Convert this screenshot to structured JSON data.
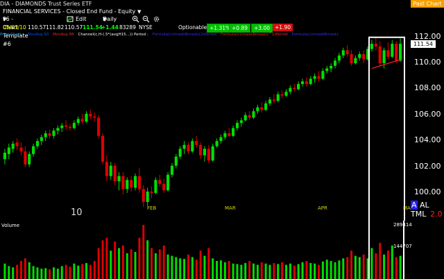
{
  "window": {
    "title": "DIA - DIAMONDS Trust Series ETF",
    "action_button": "Past Chart"
  },
  "security": {
    "description": "FINANCIAL SERVICES - Closed End Fund - Equity",
    "template": "F6 - Chart Template #6",
    "edit_label": "Edit",
    "period": "Daily"
  },
  "quote": {
    "date": "05/03/10",
    "open": "110.57",
    "high": "111.82",
    "low": "110.57",
    "last": "111.54",
    "change": "+1.44",
    "volume": "83289",
    "exchange": "NYSE",
    "optionable": "Optionable",
    "box1": "+1.31%",
    "box2": "+0.89",
    "box3": "+3.00",
    "box4": "+1.90"
  },
  "studies": [
    {
      "label": "Price Chart :",
      "color": "#00a0ff"
    },
    {
      "label": "MovAvg 50",
      "color": "#0050ff"
    },
    {
      "label": "MovAvg 88",
      "color": "#ff2020"
    },
    {
      "label": "Channel(c,H-(.5*(avgH15...)) Period :",
      "color": "#ffffff"
    },
    {
      "label": "Formula(c)(maskBmask)(2)Period",
      "color": "#3030ff"
    },
    {
      "label": "Formula(c)(maskBmask)(^2)Period",
      "color": "#ff2020"
    },
    {
      "label": "Formula(c)(maskBmask)",
      "color": "#3030ff"
    }
  ],
  "axis": {
    "y_labels": [
      "112.00",
      "110.00",
      "108.00",
      "106.00",
      "104.00",
      "102.00",
      "100.00"
    ],
    "last_price_tag": "111.54",
    "x_labels": [
      "FEB",
      "MAR",
      "APR",
      "MA"
    ],
    "x_first": "10",
    "right_indicator": "AL TML",
    "right_indicator_letter": "A",
    "right_number": "2.0"
  },
  "volume": {
    "label": "Volume",
    "scale_labels": [
      "289414",
      "144707"
    ]
  },
  "colors": {
    "up": "#00e000",
    "down": "#e00000",
    "background": "#000000",
    "accent": "#f5a000"
  },
  "icons": [
    "dropdown-icon",
    "zoom-in-icon",
    "zoom-out-icon",
    "chart-settings-icon",
    "settings-icon"
  ],
  "chart_data": {
    "type": "candlestick",
    "ylim": [
      98.5,
      112.2
    ],
    "x_labels": [
      "FEB",
      "MAR",
      "APR",
      "MA"
    ],
    "candles": [
      {
        "o": 102.6,
        "h": 103.4,
        "l": 102.2,
        "c": 103.1
      },
      {
        "o": 103.0,
        "h": 103.8,
        "l": 102.6,
        "c": 103.5
      },
      {
        "o": 103.4,
        "h": 104.0,
        "l": 103.1,
        "c": 103.8
      },
      {
        "o": 103.9,
        "h": 104.2,
        "l": 103.3,
        "c": 103.6
      },
      {
        "o": 103.5,
        "h": 103.9,
        "l": 102.9,
        "c": 103.2
      },
      {
        "o": 103.2,
        "h": 103.6,
        "l": 102.0,
        "c": 102.2
      },
      {
        "o": 102.2,
        "h": 103.2,
        "l": 102.0,
        "c": 103.0
      },
      {
        "o": 103.0,
        "h": 103.8,
        "l": 102.8,
        "c": 103.6
      },
      {
        "o": 103.6,
        "h": 104.2,
        "l": 103.4,
        "c": 104.0
      },
      {
        "o": 104.0,
        "h": 104.5,
        "l": 103.7,
        "c": 104.3
      },
      {
        "o": 104.3,
        "h": 104.8,
        "l": 104.0,
        "c": 104.6
      },
      {
        "o": 104.6,
        "h": 104.9,
        "l": 104.2,
        "c": 104.4
      },
      {
        "o": 104.4,
        "h": 105.0,
        "l": 104.2,
        "c": 104.8
      },
      {
        "o": 104.8,
        "h": 105.2,
        "l": 104.5,
        "c": 105.0
      },
      {
        "o": 105.0,
        "h": 105.4,
        "l": 104.7,
        "c": 105.2
      },
      {
        "o": 105.2,
        "h": 105.6,
        "l": 104.9,
        "c": 105.1
      },
      {
        "o": 105.1,
        "h": 105.3,
        "l": 104.8,
        "c": 105.0
      },
      {
        "o": 105.0,
        "h": 105.6,
        "l": 104.9,
        "c": 105.4
      },
      {
        "o": 105.4,
        "h": 105.9,
        "l": 105.2,
        "c": 105.7
      },
      {
        "o": 105.7,
        "h": 106.1,
        "l": 105.3,
        "c": 105.5
      },
      {
        "o": 105.5,
        "h": 106.3,
        "l": 105.4,
        "c": 106.1
      },
      {
        "o": 106.1,
        "h": 106.4,
        "l": 105.7,
        "c": 105.9
      },
      {
        "o": 105.9,
        "h": 106.2,
        "l": 105.5,
        "c": 105.8
      },
      {
        "o": 105.8,
        "h": 106.0,
        "l": 104.2,
        "c": 104.4
      },
      {
        "o": 104.4,
        "h": 104.6,
        "l": 102.2,
        "c": 102.4
      },
      {
        "o": 102.4,
        "h": 102.9,
        "l": 100.9,
        "c": 101.3
      },
      {
        "o": 101.3,
        "h": 102.4,
        "l": 101.0,
        "c": 102.1
      },
      {
        "o": 102.1,
        "h": 102.3,
        "l": 100.6,
        "c": 100.9
      },
      {
        "o": 100.9,
        "h": 101.6,
        "l": 100.2,
        "c": 101.3
      },
      {
        "o": 101.3,
        "h": 101.6,
        "l": 99.9,
        "c": 100.3
      },
      {
        "o": 100.3,
        "h": 101.2,
        "l": 100.0,
        "c": 101.0
      },
      {
        "o": 101.0,
        "h": 101.3,
        "l": 100.1,
        "c": 100.4
      },
      {
        "o": 100.4,
        "h": 101.5,
        "l": 100.2,
        "c": 101.3
      },
      {
        "o": 101.3,
        "h": 101.9,
        "l": 100.0,
        "c": 100.3
      },
      {
        "o": 100.3,
        "h": 100.6,
        "l": 98.9,
        "c": 99.3
      },
      {
        "o": 99.3,
        "h": 100.4,
        "l": 99.0,
        "c": 100.1
      },
      {
        "o": 100.1,
        "h": 100.5,
        "l": 99.6,
        "c": 100.0
      },
      {
        "o": 100.0,
        "h": 101.2,
        "l": 99.9,
        "c": 101.0
      },
      {
        "o": 101.0,
        "h": 101.4,
        "l": 100.5,
        "c": 100.7
      },
      {
        "o": 100.7,
        "h": 101.1,
        "l": 100.0,
        "c": 100.2
      },
      {
        "o": 100.2,
        "h": 101.6,
        "l": 100.1,
        "c": 101.4
      },
      {
        "o": 101.4,
        "h": 102.3,
        "l": 101.2,
        "c": 102.1
      },
      {
        "o": 102.1,
        "h": 103.0,
        "l": 101.9,
        "c": 102.8
      },
      {
        "o": 102.8,
        "h": 103.6,
        "l": 102.6,
        "c": 103.4
      },
      {
        "o": 103.4,
        "h": 104.0,
        "l": 103.0,
        "c": 103.7
      },
      {
        "o": 103.7,
        "h": 103.9,
        "l": 103.0,
        "c": 103.2
      },
      {
        "o": 103.2,
        "h": 104.2,
        "l": 103.1,
        "c": 104.0
      },
      {
        "o": 104.0,
        "h": 104.4,
        "l": 103.5,
        "c": 103.7
      },
      {
        "o": 103.7,
        "h": 103.9,
        "l": 102.6,
        "c": 102.9
      },
      {
        "o": 102.9,
        "h": 103.6,
        "l": 102.4,
        "c": 103.4
      },
      {
        "o": 103.4,
        "h": 103.7,
        "l": 102.3,
        "c": 102.5
      },
      {
        "o": 102.5,
        "h": 103.8,
        "l": 102.4,
        "c": 103.6
      },
      {
        "o": 103.6,
        "h": 104.2,
        "l": 103.5,
        "c": 104.0
      },
      {
        "o": 104.0,
        "h": 104.5,
        "l": 103.8,
        "c": 104.3
      },
      {
        "o": 104.3,
        "h": 104.8,
        "l": 104.1,
        "c": 104.6
      },
      {
        "o": 104.6,
        "h": 105.0,
        "l": 104.3,
        "c": 104.4
      },
      {
        "o": 104.4,
        "h": 105.2,
        "l": 104.3,
        "c": 105.0
      },
      {
        "o": 105.0,
        "h": 105.6,
        "l": 104.8,
        "c": 105.4
      },
      {
        "o": 105.4,
        "h": 105.8,
        "l": 105.1,
        "c": 105.6
      },
      {
        "o": 105.6,
        "h": 106.2,
        "l": 105.5,
        "c": 106.0
      },
      {
        "o": 106.0,
        "h": 106.3,
        "l": 105.6,
        "c": 105.8
      },
      {
        "o": 105.8,
        "h": 106.5,
        "l": 105.7,
        "c": 106.3
      },
      {
        "o": 106.3,
        "h": 106.8,
        "l": 106.1,
        "c": 106.6
      },
      {
        "o": 106.6,
        "h": 107.0,
        "l": 106.2,
        "c": 106.4
      },
      {
        "o": 106.4,
        "h": 107.1,
        "l": 106.3,
        "c": 106.9
      },
      {
        "o": 106.9,
        "h": 107.4,
        "l": 106.7,
        "c": 107.2
      },
      {
        "o": 107.2,
        "h": 107.6,
        "l": 106.9,
        "c": 107.1
      },
      {
        "o": 107.1,
        "h": 107.8,
        "l": 107.0,
        "c": 107.6
      },
      {
        "o": 107.6,
        "h": 107.9,
        "l": 107.3,
        "c": 107.5
      },
      {
        "o": 107.5,
        "h": 108.0,
        "l": 107.4,
        "c": 107.8
      },
      {
        "o": 107.8,
        "h": 108.3,
        "l": 107.6,
        "c": 108.1
      },
      {
        "o": 108.1,
        "h": 108.4,
        "l": 107.8,
        "c": 108.0
      },
      {
        "o": 108.0,
        "h": 108.6,
        "l": 107.9,
        "c": 108.4
      },
      {
        "o": 108.4,
        "h": 108.8,
        "l": 108.2,
        "c": 108.6
      },
      {
        "o": 108.6,
        "h": 108.9,
        "l": 108.2,
        "c": 108.4
      },
      {
        "o": 108.4,
        "h": 109.0,
        "l": 108.3,
        "c": 108.8
      },
      {
        "o": 108.8,
        "h": 109.2,
        "l": 108.5,
        "c": 109.0
      },
      {
        "o": 109.0,
        "h": 109.4,
        "l": 108.6,
        "c": 108.8
      },
      {
        "o": 108.8,
        "h": 109.6,
        "l": 108.7,
        "c": 109.4
      },
      {
        "o": 109.4,
        "h": 109.8,
        "l": 109.2,
        "c": 109.6
      },
      {
        "o": 109.6,
        "h": 110.0,
        "l": 109.3,
        "c": 109.8
      },
      {
        "o": 109.8,
        "h": 110.4,
        "l": 109.6,
        "c": 110.2
      },
      {
        "o": 110.2,
        "h": 110.8,
        "l": 110.0,
        "c": 110.6
      },
      {
        "o": 110.6,
        "h": 111.2,
        "l": 110.4,
        "c": 111.0
      },
      {
        "o": 111.0,
        "h": 111.4,
        "l": 110.5,
        "c": 110.7
      },
      {
        "o": 110.7,
        "h": 111.0,
        "l": 109.8,
        "c": 110.0
      },
      {
        "o": 110.0,
        "h": 110.6,
        "l": 109.9,
        "c": 110.4
      },
      {
        "o": 110.4,
        "h": 110.9,
        "l": 110.2,
        "c": 110.7
      },
      {
        "o": 110.7,
        "h": 111.0,
        "l": 110.0,
        "c": 110.3
      },
      {
        "o": 110.3,
        "h": 111.3,
        "l": 110.2,
        "c": 111.1
      },
      {
        "o": 111.1,
        "h": 111.8,
        "l": 110.9,
        "c": 111.5
      },
      {
        "o": 111.5,
        "h": 112.0,
        "l": 111.0,
        "c": 111.3
      },
      {
        "o": 111.3,
        "h": 111.7,
        "l": 109.8,
        "c": 110.0
      },
      {
        "o": 110.0,
        "h": 111.2,
        "l": 109.6,
        "c": 111.0
      },
      {
        "o": 111.0,
        "h": 111.6,
        "l": 110.3,
        "c": 110.5
      },
      {
        "o": 110.5,
        "h": 111.8,
        "l": 110.4,
        "c": 111.5
      },
      {
        "o": 111.5,
        "h": 111.7,
        "l": 110.0,
        "c": 110.2
      },
      {
        "o": 110.2,
        "h": 111.9,
        "l": 110.1,
        "c": 111.5
      }
    ],
    "volume": [
      60,
      50,
      45,
      55,
      70,
      80,
      65,
      50,
      45,
      40,
      42,
      38,
      45,
      40,
      50,
      55,
      48,
      60,
      52,
      58,
      62,
      55,
      70,
      120,
      150,
      160,
      110,
      145,
      120,
      130,
      100,
      115,
      105,
      160,
      210,
      150,
      120,
      100,
      115,
      130,
      95,
      90,
      85,
      80,
      78,
      95,
      85,
      75,
      110,
      90,
      120,
      80,
      70,
      72,
      65,
      70,
      60,
      58,
      55,
      62,
      70,
      60,
      55,
      65,
      60,
      55,
      62,
      58,
      65,
      55,
      60,
      52,
      58,
      65,
      70,
      62,
      60,
      55,
      68,
      75,
      70,
      65,
      72,
      80,
      85,
      110,
      90,
      85,
      95,
      80,
      120,
      100,
      140,
      95,
      110,
      130,
      85,
      90
    ],
    "volume_max": 289414
  }
}
